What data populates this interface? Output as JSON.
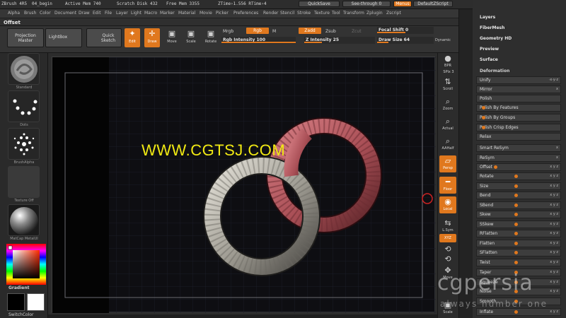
{
  "titlebar": {
    "app": "ZBrush 4R5",
    "document": "04_begin",
    "active_mem": "Active Mem 740",
    "scratch": "Scratch Disk 432",
    "free_mem": "Free Mem 3355",
    "ztime": "ZTime›1.556 RTime›4",
    "quicksave": "QuickSave",
    "seethrough": "See-through  0",
    "menus": "Menus",
    "default_script": "DefaultZScript"
  },
  "menubar": {
    "items": [
      "Alpha",
      "Brush",
      "Color",
      "Document",
      "Draw",
      "Edit",
      "File",
      "Layer",
      "Light",
      "Macro",
      "Marker",
      "Material",
      "Movie",
      "Picker",
      "Preferences",
      "Render",
      "Stencil",
      "Stroke",
      "Texture",
      "Tool",
      "Transform",
      "Zplugin",
      "Zscript"
    ]
  },
  "palette_title": "Offset",
  "toolbar": {
    "projection_master": "Projection Master",
    "lightbox": "LightBox",
    "quick_sketch": "Quick Sketch",
    "edit": "Edit",
    "draw": "Draw",
    "move": "Move",
    "scale": "Scale",
    "rotate": "Rotate",
    "mrgb": "Mrgb",
    "rgb": "Rgb",
    "m": "M",
    "zadd": "Zadd",
    "zsub": "Zsub",
    "zcut": "Zcut",
    "rgb_intensity": "Rgb Intensity 100",
    "z_intensity": "Z Intensity 25",
    "focal_shift": "Focal Shift 0",
    "draw_size": "Draw Size 64",
    "dynamic": "Dynamic"
  },
  "leftpanel": {
    "brush": "Standard",
    "stroke": "Dots",
    "alpha": "BrushAlpha",
    "texture": "Texture Off",
    "material": "MatCap MetalUI",
    "gradient": "Gradient",
    "switchcolor": "SwitchColor"
  },
  "watermark": "WWW.CGTSJ.COM",
  "rightstrip": {
    "bpr": "BPR",
    "spix": "SPix 3",
    "scroll": "Scroll",
    "zoom": "Zoom",
    "actual": "Actual",
    "aahalf": "AAHalf",
    "persp": "Persp",
    "floor": "Floor",
    "local": "Local",
    "lsym": "L.Sym",
    "xyz": "XYZ",
    "move": "Move",
    "scale": "Scale"
  },
  "tray": {
    "top_items": [
      "Layers",
      "FiberMesh",
      "Geometry HD",
      "Preview",
      "Surface"
    ],
    "deformation_title": "Deformation",
    "rows": [
      {
        "label": "Unify",
        "sym": "·x·y·z",
        "fill": 0
      },
      {
        "label": "Mirror",
        "sym": "x",
        "fill": 0
      },
      {
        "label": "Polish",
        "sym": "",
        "fill": 0
      },
      {
        "label": "Polish By Features",
        "sym": "",
        "fill": 0.06
      },
      {
        "label": "Polish By Groups",
        "sym": "",
        "fill": 0.06
      },
      {
        "label": "Polish Crisp Edges",
        "sym": "",
        "fill": 0.06
      },
      {
        "label": "Relax",
        "sym": "",
        "fill": 0
      },
      {
        "label": "Smart ReSym",
        "sym": "x",
        "fill": 0
      },
      {
        "label": "ReSym",
        "sym": "x",
        "fill": 0
      },
      {
        "label": "Offset",
        "sym": "x y z",
        "fill": 0.2
      },
      {
        "label": "Rotate",
        "sym": "x y z",
        "fill": 0.45
      },
      {
        "label": "Size",
        "sym": "x y z",
        "fill": 0.45
      },
      {
        "label": "Bend",
        "sym": "x y z",
        "fill": 0.45
      },
      {
        "label": "SBend",
        "sym": "x y z",
        "fill": 0.45
      },
      {
        "label": "Skew",
        "sym": "x y z",
        "fill": 0.45
      },
      {
        "label": "SSkew",
        "sym": "x y z",
        "fill": 0.45
      },
      {
        "label": "RFlatten",
        "sym": "x y z",
        "fill": 0.45
      },
      {
        "label": "Flatten",
        "sym": "x y z",
        "fill": 0.45
      },
      {
        "label": "SFlatten",
        "sym": "x y z",
        "fill": 0.45
      },
      {
        "label": "Twist",
        "sym": "x y z",
        "fill": 0.45
      },
      {
        "label": "Taper",
        "sym": "x y z",
        "fill": 0.45
      },
      {
        "label": "Squeeze",
        "sym": "x y z",
        "fill": 0.45
      },
      {
        "label": "Noise",
        "sym": "x y z",
        "fill": 0.45
      },
      {
        "label": "Smooth",
        "sym": "",
        "fill": 0.45
      },
      {
        "label": "Inflate",
        "sym": "x y z",
        "fill": 0.45
      }
    ]
  },
  "brand": {
    "name": "cgpersia",
    "tagline": "always number one"
  },
  "colors": {
    "accent": "#e0781e",
    "watermark": "#f2ea12",
    "ring_front": "#b9b6ad",
    "ring_back": "#b05a60"
  }
}
